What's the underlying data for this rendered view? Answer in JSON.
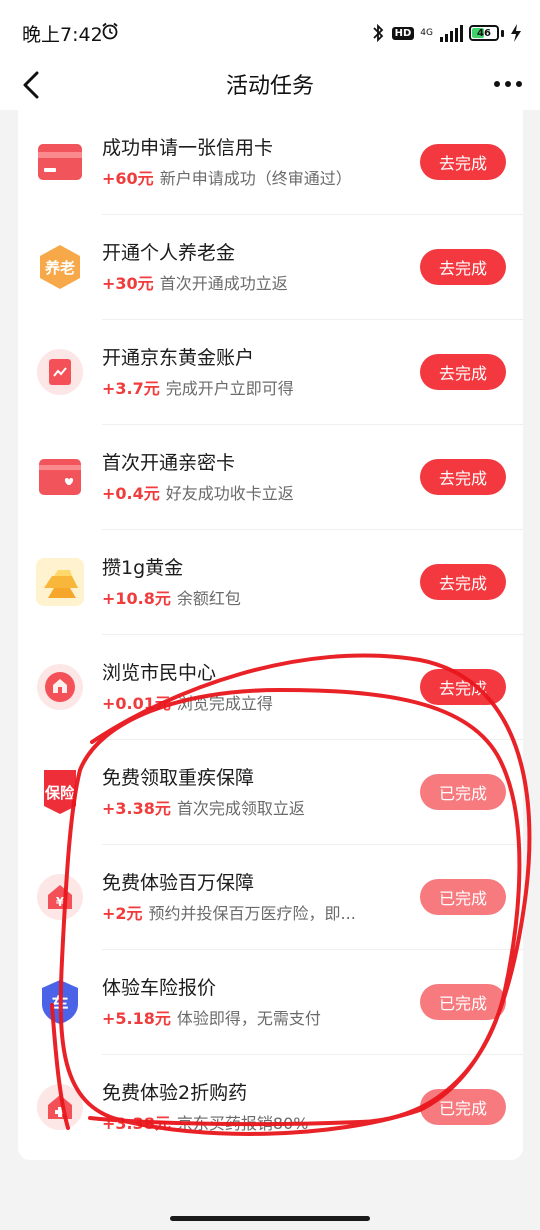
{
  "status_bar": {
    "time": "晚上7:42",
    "hd": "HD",
    "network": "4G",
    "battery": "46",
    "battery_level": 0.46
  },
  "header": {
    "title": "活动任务"
  },
  "colors": {
    "accent": "#f3393f",
    "accent_done": "#f77a7f",
    "reward": "#f03c3c"
  },
  "tasks": [
    {
      "icon": "credit-card-icon",
      "title": "成功申请一张信用卡",
      "reward": "+60元",
      "desc": "新户申请成功（终审通过）",
      "button": "去完成"
    },
    {
      "icon": "pension-icon",
      "icon_text": "养老",
      "title": "开通个人养老金",
      "reward": "+30元",
      "desc": "首次开通成功立返",
      "button": "去完成"
    },
    {
      "icon": "gold-account-icon",
      "title": "开通京东黄金账户",
      "reward": "+3.7元",
      "desc": "完成开户立即可得",
      "button": "去完成"
    },
    {
      "icon": "family-card-icon",
      "title": "首次开通亲密卡",
      "reward": "+0.4元",
      "desc": "好友成功收卡立返",
      "button": "去完成"
    },
    {
      "icon": "gold-bar-icon",
      "title": "攒1g黄金",
      "reward": "+10.8元",
      "desc": "余额红包",
      "button": "去完成"
    },
    {
      "icon": "citizen-center-icon",
      "title": "浏览市民中心",
      "reward": "+0.01元",
      "desc": "浏览完成立得",
      "button": "去完成"
    },
    {
      "icon": "insurance-icon",
      "icon_text": "保险",
      "title": "免费领取重疾保障",
      "reward": "+3.38元",
      "desc": "首次完成领取立返",
      "button": "已完成"
    },
    {
      "icon": "medical-insurance-icon",
      "icon_text": "¥",
      "title": "免费体验百万保障",
      "reward": "+2元",
      "desc": "预约并投保百万医疗险，即...",
      "button": "已完成"
    },
    {
      "icon": "car-insurance-icon",
      "icon_text": "车",
      "title": "体验车险报价",
      "reward": "+5.18元",
      "desc": "体验即得，无需支付",
      "button": "已完成"
    },
    {
      "icon": "pharmacy-icon",
      "title": "免费体验2折购药",
      "reward": "+3.38元",
      "desc": "京东买药报销80%",
      "button": "已完成"
    }
  ]
}
